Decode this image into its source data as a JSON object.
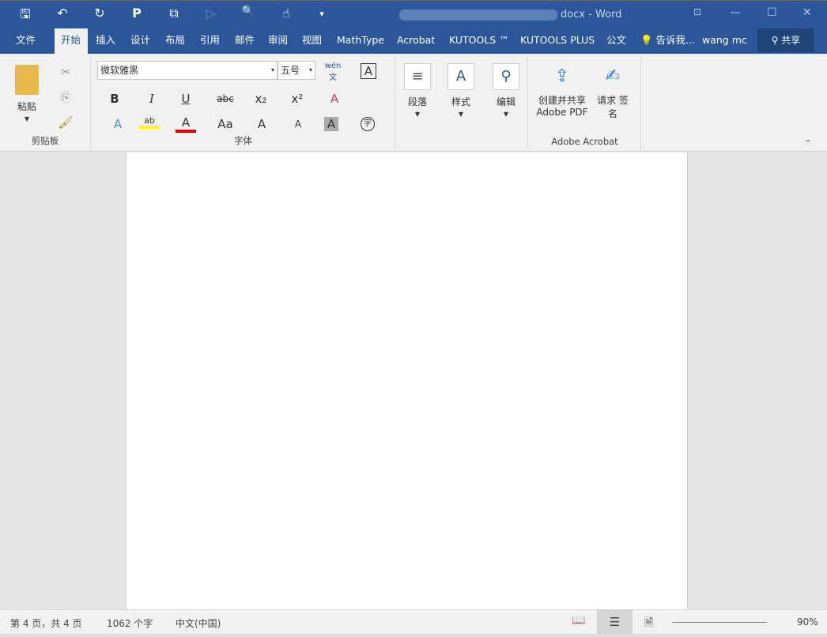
{
  "window": {
    "title": "docx - Word",
    "minimize": "—",
    "maximize": "☐",
    "close": "✕",
    "ribbon_display": "⊡"
  },
  "quick_access": [
    {
      "icon": "save-icon",
      "glyph": "🖫"
    },
    {
      "icon": "undo-icon",
      "glyph": "↶"
    },
    {
      "icon": "redo-icon",
      "glyph": "↻"
    },
    {
      "icon": "publisher-icon",
      "glyph": "P"
    },
    {
      "icon": "copy-format-icon",
      "glyph": "⧉"
    },
    {
      "icon": "comment-icon",
      "glyph": "▷"
    },
    {
      "icon": "print-preview-icon",
      "glyph": "🔍"
    },
    {
      "icon": "touch-mode-icon",
      "glyph": "☝"
    },
    {
      "icon": "customize-icon",
      "glyph": "▾"
    }
  ],
  "tabs": [
    "文件",
    "开始",
    "插入",
    "设计",
    "布局",
    "引用",
    "邮件",
    "审阅",
    "视图",
    "MathType",
    "Acrobat",
    "KUTOOLS ™",
    "KUTOOLS PLUS",
    "公文"
  ],
  "tell_me": "告诉我...",
  "user": "wang mc",
  "share": "共享",
  "clipboard": {
    "paste": "粘贴",
    "label": "剪贴板"
  },
  "font": {
    "name": "微软雅黑",
    "size": "五号",
    "label": "字体",
    "buttons": [
      "B",
      "I",
      "U",
      "abc",
      "x₂",
      "x²",
      "A",
      "ab",
      "A",
      "Aa",
      "A",
      "A",
      "A",
      "字",
      "wén文"
    ]
  },
  "paragraph": {
    "label": "段落"
  },
  "styles": {
    "label": "样式"
  },
  "editing": {
    "label": "编辑"
  },
  "acrobat": {
    "create": "创建并共享 Adobe PDF",
    "sign": "请求 签名",
    "label": "Adobe Acrobat"
  },
  "status": {
    "page": "第 4 页，共 4 页",
    "words": "1062 个字",
    "language": "中文(中国)",
    "zoom": "90%"
  },
  "colors": {
    "accent": "#2b579a",
    "highlight": "#ffff00",
    "font_color": "#e00000"
  }
}
